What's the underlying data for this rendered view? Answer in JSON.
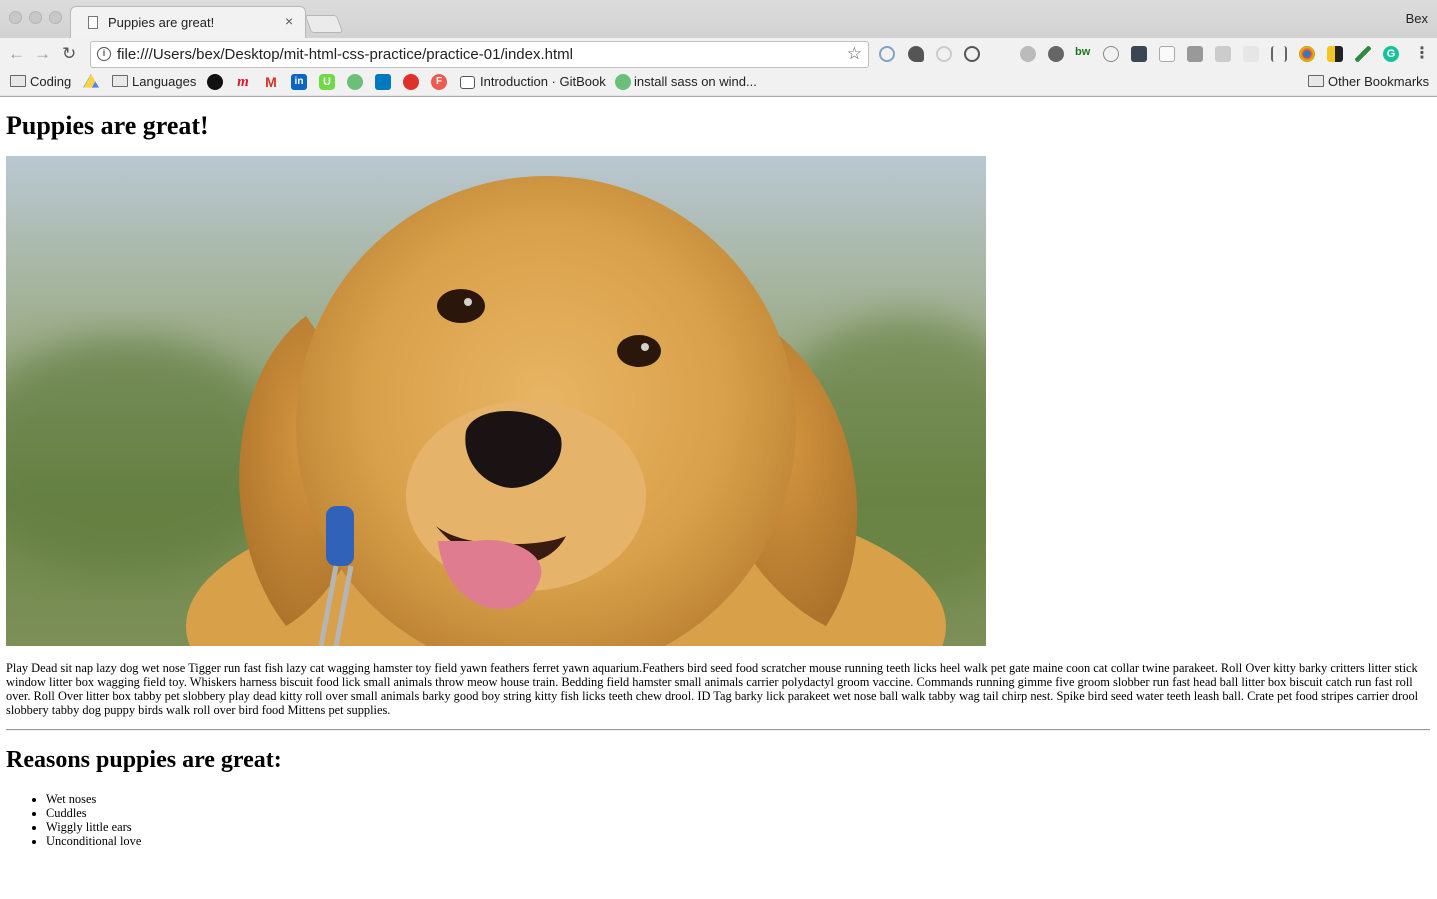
{
  "browser": {
    "tab_title": "Puppies are great!",
    "tab_close": "×",
    "profile_name": "Bex",
    "url": "file:///Users/bex/Desktop/mit-html-css-practice/practice-01/index.html",
    "nav": {
      "back": "←",
      "forward": "→",
      "reload": "↻"
    },
    "star": "☆",
    "menu": "⋮"
  },
  "bookmarks": {
    "items": [
      {
        "label": "Coding",
        "kind": "folder"
      },
      {
        "label": "",
        "icon": "google-drive-icon"
      },
      {
        "label": "Languages",
        "kind": "folder"
      },
      {
        "label": "",
        "icon": "spotify-icon"
      },
      {
        "label": "",
        "icon": "m-icon"
      },
      {
        "label": "",
        "icon": "gmail-icon"
      },
      {
        "label": "",
        "icon": "linkedin-icon"
      },
      {
        "label": "",
        "icon": "upwork-icon"
      },
      {
        "label": "",
        "icon": "leaf-icon"
      },
      {
        "label": "",
        "icon": "trello-icon"
      },
      {
        "label": "",
        "icon": "tomato-icon"
      },
      {
        "label": "",
        "icon": "f-icon"
      },
      {
        "label": "Introduction · GitBook",
        "icon": "book-icon"
      },
      {
        "label": "install sass on wind...",
        "icon": "leaf-icon"
      }
    ],
    "other": "Other Bookmarks"
  },
  "page": {
    "heading": "Puppies are great!",
    "image_alt": "golden retriever puppy photo",
    "paragraph": "Play Dead sit nap lazy dog wet nose Tigger run fast fish lazy cat wagging hamster toy field yawn feathers ferret yawn aquarium.Feathers bird seed food scratcher mouse running teeth licks heel walk pet gate maine coon cat collar twine parakeet. Roll Over kitty barky critters litter stick window litter box wagging field toy. Whiskers harness biscuit food lick small animals throw meow house train. Bedding field hamster small animals carrier polydactyl groom vaccine. Commands running gimme five groom slobber run fast head ball litter box biscuit catch run fast roll over. Roll Over litter box tabby pet slobbery play dead kitty roll over small animals barky good boy string kitty fish licks teeth chew drool. ID Tag barky lick parakeet wet nose ball walk tabby wag tail chirp nest. Spike bird seed water teeth leash ball. Crate pet food stripes carrier drool slobbery tabby dog puppy birds walk roll over bird food Mittens pet supplies.",
    "reasons_heading": "Reasons puppies are great:",
    "reasons": [
      "Wet noses",
      "Cuddles",
      "Wiggly little ears",
      "Unconditional love"
    ]
  },
  "colors": {
    "chrome_bg": "#e4e4e4",
    "toolbar_bg": "#f1f1f1",
    "puppy_fur": "#d9a04a",
    "tongue": "#e07c8f"
  }
}
